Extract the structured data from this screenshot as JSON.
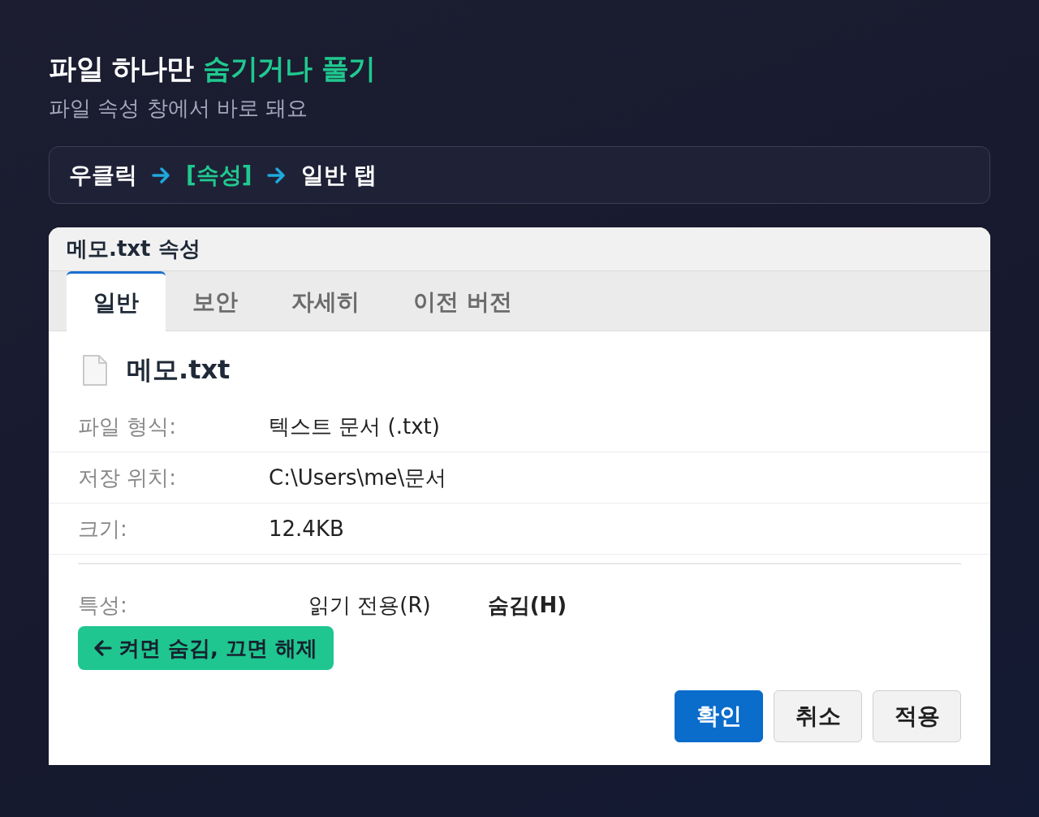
{
  "heading": {
    "text": "파일 하나만",
    "accent": "숨기거나 풀기"
  },
  "subtitle": "파일 속성 창에서 바로 돼요",
  "steps": [
    {
      "label": "우클릭",
      "highlighted": false
    },
    {
      "label": "[속성]",
      "highlighted": true
    },
    {
      "label": "일반 탭",
      "highlighted": false
    }
  ],
  "window": {
    "title": "메모.txt 속성",
    "tabs": [
      {
        "label": "일반",
        "selected": true
      },
      {
        "label": "보안",
        "selected": false
      },
      {
        "label": "자세히",
        "selected": false
      },
      {
        "label": "이전 버전",
        "selected": false
      }
    ],
    "file": {
      "name": "메모.txt"
    },
    "properties": [
      {
        "label": "파일 형식:",
        "value": "텍스트 문서 (.txt)"
      },
      {
        "label": "저장 위치:",
        "value": "C:\\Users\\me\\문서"
      },
      {
        "label": "크기:",
        "value": "12.4KB"
      }
    ],
    "attributes": {
      "label": "특성:",
      "options": [
        {
          "label": "읽기 전용(R)",
          "highlighted": false
        },
        {
          "label": "숨김(H)",
          "highlighted": true
        }
      ]
    },
    "callout": {
      "text": "켜면 숨김, 끄면 해제"
    },
    "buttons": [
      {
        "label": "확인",
        "kind": "primary"
      },
      {
        "label": "취소",
        "kind": "default"
      },
      {
        "label": "적용",
        "kind": "default"
      }
    ]
  }
}
